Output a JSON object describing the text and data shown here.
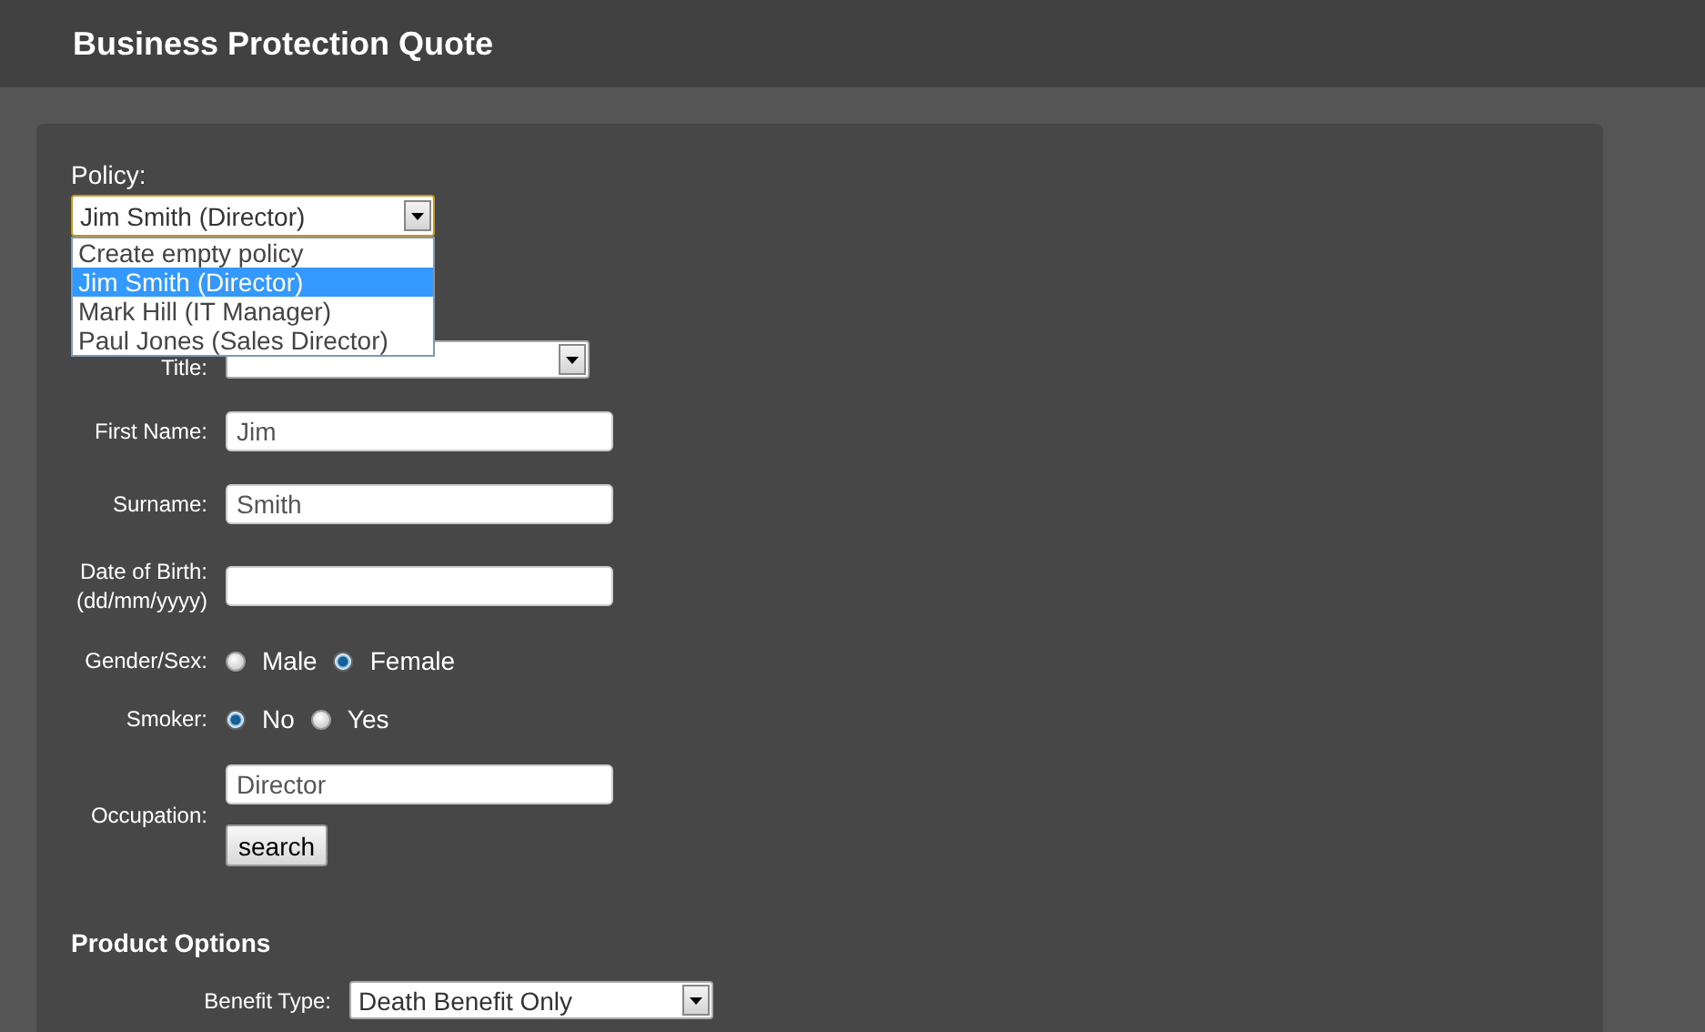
{
  "header": {
    "title": "Business Protection Quote"
  },
  "policy": {
    "label": "Policy:",
    "value": "Jim Smith (Director)",
    "expanded": true,
    "options": [
      {
        "label": "Create empty policy",
        "selected": false
      },
      {
        "label": "Jim Smith (Director)",
        "selected": true
      },
      {
        "label": "Mark Hill (IT Manager)",
        "selected": false
      },
      {
        "label": "Paul Jones (Sales Director)",
        "selected": false
      }
    ]
  },
  "fields": [
    {
      "kind": "select",
      "label": "Title:"
    },
    {
      "kind": "text",
      "label": "First Name:",
      "value": "Jim"
    },
    {
      "kind": "text",
      "label": "Surname:",
      "value": "Smith"
    },
    {
      "kind": "text",
      "label": "Date of Birth:",
      "sublabel": "(dd/mm/yyyy)"
    },
    {
      "kind": "radio",
      "label": "Gender/Sex:",
      "options": [
        {
          "label": "Male",
          "selected": false
        },
        {
          "label": "Female",
          "selected": true
        }
      ]
    },
    {
      "kind": "radio",
      "label": "Smoker:",
      "options": [
        {
          "label": "No",
          "selected": true
        },
        {
          "label": "Yes",
          "selected": false
        }
      ]
    },
    {
      "kind": "search",
      "label": "Occupation:",
      "value": "Director",
      "button": "search"
    }
  ],
  "product_options": {
    "heading": "Product Options",
    "fields": [
      {
        "label": "Benefit Type:",
        "value": "Death Benefit Only"
      }
    ]
  }
}
